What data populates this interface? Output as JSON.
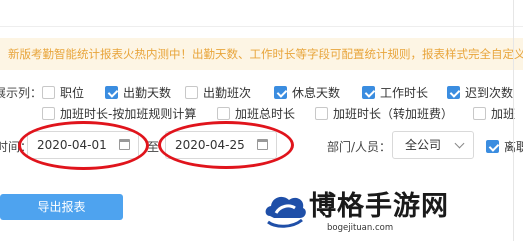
{
  "notice": {
    "text": "新版考勤智能统计报表火热内测中！出勤天数、工作时长等字段可配置统计规则，报表样式完全自定义"
  },
  "columns": {
    "label": "展示列：",
    "items": [
      {
        "label": "职位",
        "checked": false
      },
      {
        "label": "出勤天数",
        "checked": true
      },
      {
        "label": "出勤班次",
        "checked": false
      },
      {
        "label": "休息天数",
        "checked": true
      },
      {
        "label": "工作时长",
        "checked": true
      },
      {
        "label": "迟到次数",
        "checked": true
      },
      {
        "label": "加班时长-按加班规则计算",
        "checked": false
      },
      {
        "label": "加班总时长",
        "checked": false
      },
      {
        "label": "加班时长（转加班费）",
        "checked": false
      },
      {
        "label": "加班",
        "checked": false
      }
    ]
  },
  "time": {
    "label": "时间：",
    "start": "2020-04-01",
    "to": "至",
    "end": "2020-04-25"
  },
  "dept": {
    "label": "部门/人员：",
    "value": "全公司",
    "extra_label": "离职",
    "extra_checked": true
  },
  "export": {
    "label": "导出报表"
  },
  "watermark": {
    "title": "博格手游网",
    "url": "bogejituan.com"
  },
  "colors": {
    "accent": "#3b8de0",
    "notice_text": "#e8a53c",
    "highlight": "#e0141c",
    "button": "#4ea3ef"
  }
}
